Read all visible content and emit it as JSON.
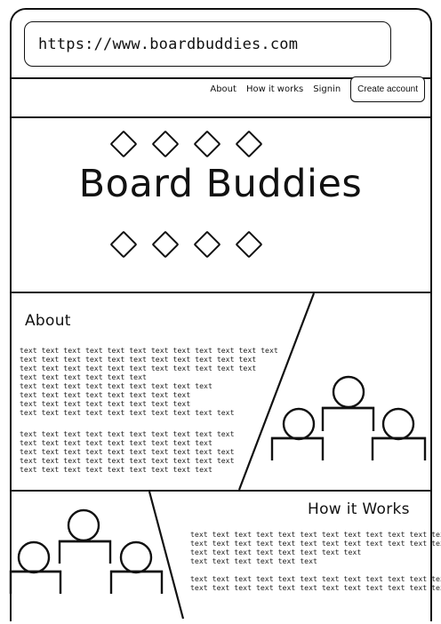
{
  "browser": {
    "url": "https://www.boardbuddies.com"
  },
  "nav": {
    "about": "About",
    "how_it_works": "How it works",
    "signin": "Signin",
    "create_account": "Create account"
  },
  "hero": {
    "title": "Board Buddies"
  },
  "about": {
    "title": "About",
    "paragraph_1": "text text text text text text text text text text text text\ntext text text text text text text text text text text\ntext text text text text text text text text text text\ntext text text text text text\ntext text text text text text text text text\ntext text text text text text text text\ntext text text text text text text text\ntext text text text text text text text text text",
    "paragraph_2": "text text text text text text text text text text\ntext text text text text text text text text\ntext text text text text text text text text text\ntext text text text text text text text text text\ntext text text text text text text text text"
  },
  "how_it_works": {
    "title": "How it Works",
    "paragraph_1": "text text text text text text text text text text text text\ntext text text text text text text text text text text text\ntext text text text text text text text\ntext text text text text text",
    "paragraph_2": "text text text text text text text text text text text text\ntext text text text text text text text text text text text"
  }
}
